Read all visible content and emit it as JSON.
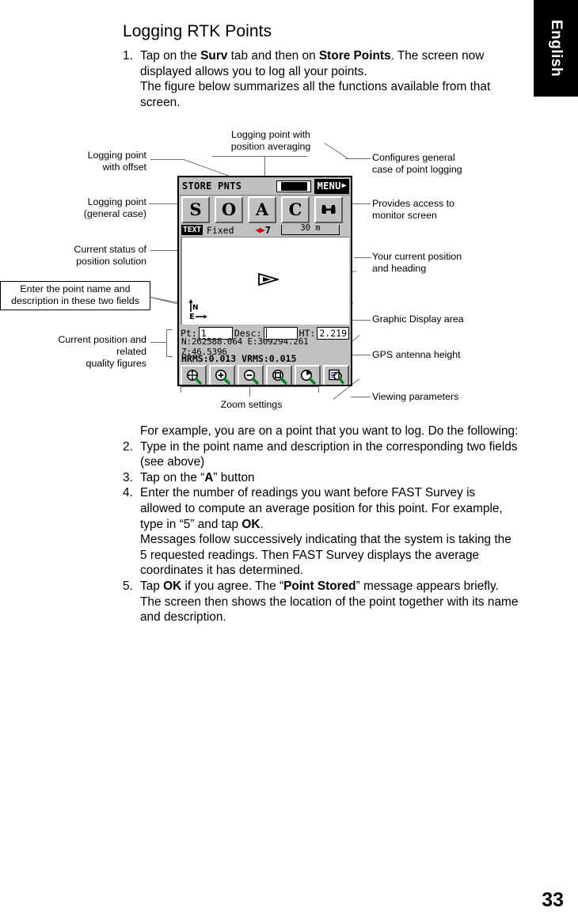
{
  "language_tab": {
    "label": "English"
  },
  "page_number": "33",
  "heading": "Logging RTK Points",
  "steps": [
    {
      "num": "1.",
      "parts": [
        {
          "t": "Tap on the ",
          "b": false
        },
        {
          "t": "Surv",
          "b": true
        },
        {
          "t": " tab and then on ",
          "b": false
        },
        {
          "t": "Store Points",
          "b": true
        },
        {
          "t": ". The screen now displayed allows you to log all your points.",
          "b": false
        }
      ],
      "continuation": "The figure below summarizes all the functions available from that screen."
    },
    {
      "num": "",
      "intro": "For example, you are on a point that you want to log. Do the following:"
    },
    {
      "num": "2.",
      "parts": [
        {
          "t": "Type in the point name and description in the corresponding two fields (see above)",
          "b": false
        }
      ]
    },
    {
      "num": "3.",
      "parts": [
        {
          "t": "Tap on the “",
          "b": false
        },
        {
          "t": "A",
          "b": true
        },
        {
          "t": "” button",
          "b": false
        }
      ]
    },
    {
      "num": "4.",
      "parts": [
        {
          "t": "Enter the number of readings you want before FAST Survey is allowed to compute an average position for this point. For example, type in “5” and tap ",
          "b": false
        },
        {
          "t": "OK",
          "b": true
        },
        {
          "t": ".",
          "b": false
        }
      ],
      "continuation": "Messages follow successively indicating that the system is taking the 5 requested readings. Then FAST Survey displays the average coordinates it has determined."
    },
    {
      "num": "5.",
      "parts": [
        {
          "t": "Tap ",
          "b": false
        },
        {
          "t": "OK",
          "b": true
        },
        {
          "t": " if you agree. The “",
          "b": false
        },
        {
          "t": "Point Stored",
          "b": true
        },
        {
          "t": "” message appears briefly. The screen then shows the location of the point together with its name and description.",
          "b": false
        }
      ]
    }
  ],
  "callouts": {
    "logging_point_offset": "Logging point\nwith offset",
    "logging_point_general": "Logging point\n(general case)",
    "current_status": "Current status of\nposition solution",
    "enter_point_name": "Enter the point name and\ndescription in these two fields",
    "current_position_quality": "Current position and related\nquality figures",
    "logging_point_averaging": "Logging point with\nposition averaging",
    "configures_general": "Configures general\ncase of point logging",
    "provides_access": "Provides access to\nmonitor screen",
    "your_current_position": "Your current position\nand heading",
    "graphic_display_area": "Graphic Display area",
    "gps_antenna_height": "GPS antenna height",
    "viewing_parameters": "Viewing parameters",
    "zoom_settings": "Zoom settings"
  },
  "device": {
    "title": "STORE PNTS",
    "menu_label": "MENU",
    "menu_arrow": "▶",
    "toolbar_buttons": [
      {
        "name": "store-point-button",
        "label": "S"
      },
      {
        "name": "offset-point-button",
        "label": "O"
      },
      {
        "name": "average-point-button",
        "label": "A"
      },
      {
        "name": "configure-button",
        "label": "C"
      },
      {
        "name": "monitor-button",
        "label": "☲"
      }
    ],
    "status": {
      "text_tag": "TEXT",
      "fix_status": "Fixed",
      "satellite_icon": "◀▶",
      "satellite_count": "7",
      "scale": "30 m"
    },
    "axis": {
      "north": "N",
      "east": "E"
    },
    "fields": {
      "pt_label": "Pt:",
      "pt_value": "1",
      "desc_label": "Desc:",
      "desc_value": "",
      "ht_label": "HT:",
      "ht_value": "2.219"
    },
    "coordinates": "N:262588.064 E:309294.261 Z:46.5396",
    "rms": "HRMS:0.013 VRMS:0.015",
    "zoom_buttons": [
      {
        "name": "zoom-pan-button"
      },
      {
        "name": "zoom-in-button"
      },
      {
        "name": "zoom-out-button"
      },
      {
        "name": "zoom-window-button"
      },
      {
        "name": "zoom-extents-button"
      },
      {
        "name": "view-settings-button"
      }
    ]
  }
}
